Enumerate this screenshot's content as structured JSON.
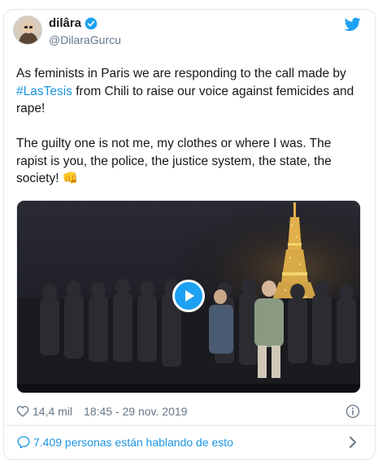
{
  "tweet": {
    "author": {
      "display_name": "dilâra",
      "handle": "@DilaraGurcu",
      "verified": true
    },
    "text": {
      "line1_before": "As feminists in Paris we are responding to the call made by ",
      "hashtag": "#LasTesis",
      "line1_after": " from Chili to raise our voice against femicides and rape!",
      "paragraph2": "The guilty one is not me, my clothes or where I was. The rapist is you, the police, the justice system, the state, the society!",
      "emoji": "👊"
    },
    "media": {
      "type": "video",
      "play_icon": "play-icon"
    },
    "meta": {
      "likes": "14,4 mil",
      "timestamp": "18:45 - 29 nov. 2019"
    },
    "conversation": {
      "label": "7.409 personas están hablando de esto"
    }
  },
  "colors": {
    "twitter_blue": "#1da1f2",
    "link_blue": "#1b95e0",
    "text_primary": "#14171a",
    "text_secondary": "#657786",
    "border": "#e1e8ed"
  }
}
